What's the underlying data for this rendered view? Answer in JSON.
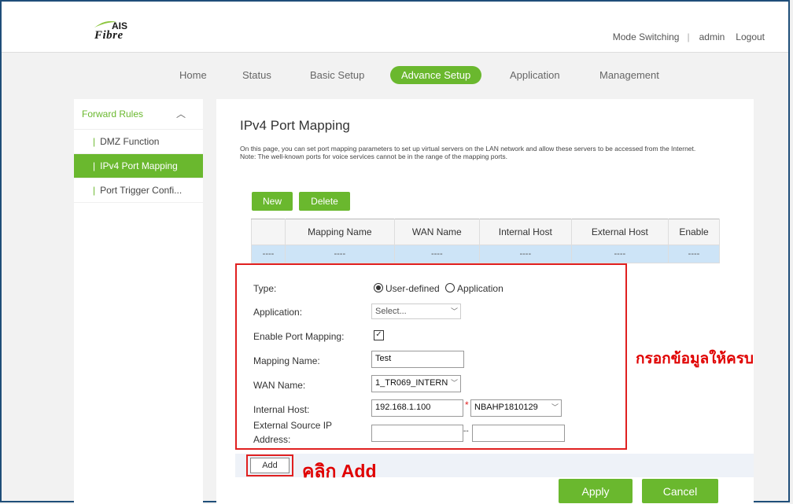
{
  "header": {
    "logo_top": "AIS",
    "logo_bottom": "Fibre",
    "links": {
      "mode_switching": "Mode Switching",
      "user": "admin",
      "logout": "Logout"
    }
  },
  "nav": {
    "home": "Home",
    "status": "Status",
    "basic_setup": "Basic Setup",
    "advance_setup": "Advance Setup",
    "application": "Application",
    "management": "Management"
  },
  "sidebar": {
    "section": "Forward Rules",
    "items": [
      {
        "label": "DMZ Function"
      },
      {
        "label": "IPv4 Port Mapping"
      },
      {
        "label": "Port Trigger Confi..."
      }
    ]
  },
  "main": {
    "title": "IPv4 Port Mapping",
    "desc1": "On this page, you can set port mapping parameters to set up virtual servers on the LAN network and allow these servers to be accessed from the Internet.",
    "desc2": "Note: The well-known ports for voice services cannot be in the range of the mapping ports.",
    "new_label": "New",
    "delete_label": "Delete",
    "table": {
      "headers": [
        "",
        "Mapping Name",
        "WAN Name",
        "Internal Host",
        "External Host",
        "Enable"
      ],
      "row": [
        "----",
        "----",
        "----",
        "----",
        "----",
        "----"
      ]
    }
  },
  "form": {
    "type_label": "Type:",
    "type_user_defined": "User-defined",
    "type_application": "Application",
    "application_label": "Application:",
    "application_value": "Select...",
    "enable_label": "Enable Port Mapping:",
    "mapping_name_label": "Mapping Name:",
    "mapping_name_value": "Test",
    "wan_label": "WAN Name:",
    "wan_value": "1_TR069_INTERN",
    "internal_host_label": "Internal Host:",
    "internal_host_value": "192.168.1.100",
    "internal_host_required": "*",
    "internal_host_device": "NBAHP1810129",
    "external_ip_label_1": "External Source IP",
    "external_ip_label_2": "Address:",
    "external_ip_start": "",
    "external_ip_end": "",
    "range_sep": "--",
    "add_label": "Add",
    "apply_label": "Apply",
    "cancel_label": "Cancel"
  },
  "annotations": {
    "fill_info": "กรอกข้อมูลให้ครบ",
    "click_add": "คลิก Add"
  },
  "colors": {
    "accent": "#6ab82e",
    "highlight": "#e02020",
    "row": "#cde4f7"
  }
}
